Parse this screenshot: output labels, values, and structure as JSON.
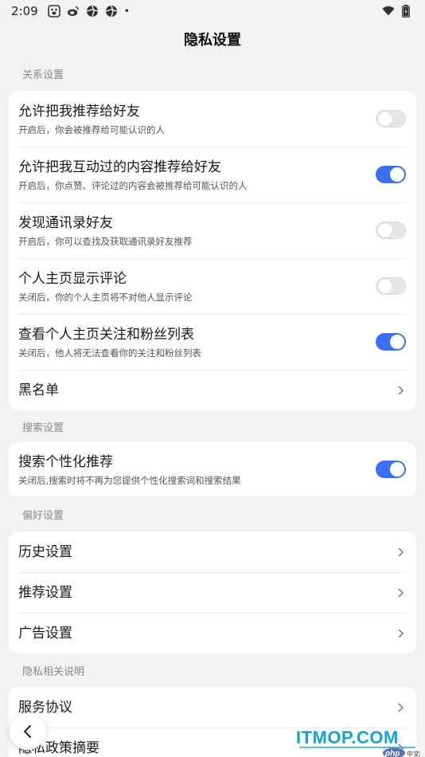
{
  "status": {
    "time": "2:09",
    "dot": "•"
  },
  "header": {
    "title": "隐私设置"
  },
  "sections": {
    "relations": {
      "label": "关系设置",
      "items": [
        {
          "title": "允许把我推荐给好友",
          "desc": "开启后，你会被推荐给可能认识的人",
          "toggle": "off"
        },
        {
          "title": "允许把我互动过的内容推荐给好友",
          "desc": "开启后，你点赞、评论过的内容会被推荐给可能认识的人",
          "toggle": "on"
        },
        {
          "title": "发现通讯录好友",
          "desc": "开启后，你可以查找及获取通讯录好友推荐",
          "toggle": "off"
        },
        {
          "title": "个人主页显示评论",
          "desc": "关闭后，你的个人主页将不对他人显示评论",
          "toggle": "off"
        },
        {
          "title": "查看个人主页关注和粉丝列表",
          "desc": "关闭后，他人将无法查看你的关注和粉丝列表",
          "toggle": "on"
        }
      ],
      "blacklist": "黑名单"
    },
    "search": {
      "label": "搜索设置",
      "item": {
        "title": "搜索个性化推荐",
        "desc": "关闭后,搜索时将不再为您提供个性化搜索词和搜索结果",
        "toggle": "on"
      }
    },
    "preferences": {
      "label": "偏好设置",
      "items": [
        "历史设置",
        "推荐设置",
        "广告设置"
      ]
    },
    "privacy_notes": {
      "label": "隐私相关说明",
      "items": [
        "服务协议",
        "隐私政策摘要"
      ]
    }
  },
  "watermark": {
    "brand": "ITMOP.COM",
    "php_text": "php",
    "cn_text": "中文网"
  },
  "colors": {
    "accent": "#3b6ff2",
    "watermark": "#12a3d8",
    "background": "#f2f2f4"
  }
}
